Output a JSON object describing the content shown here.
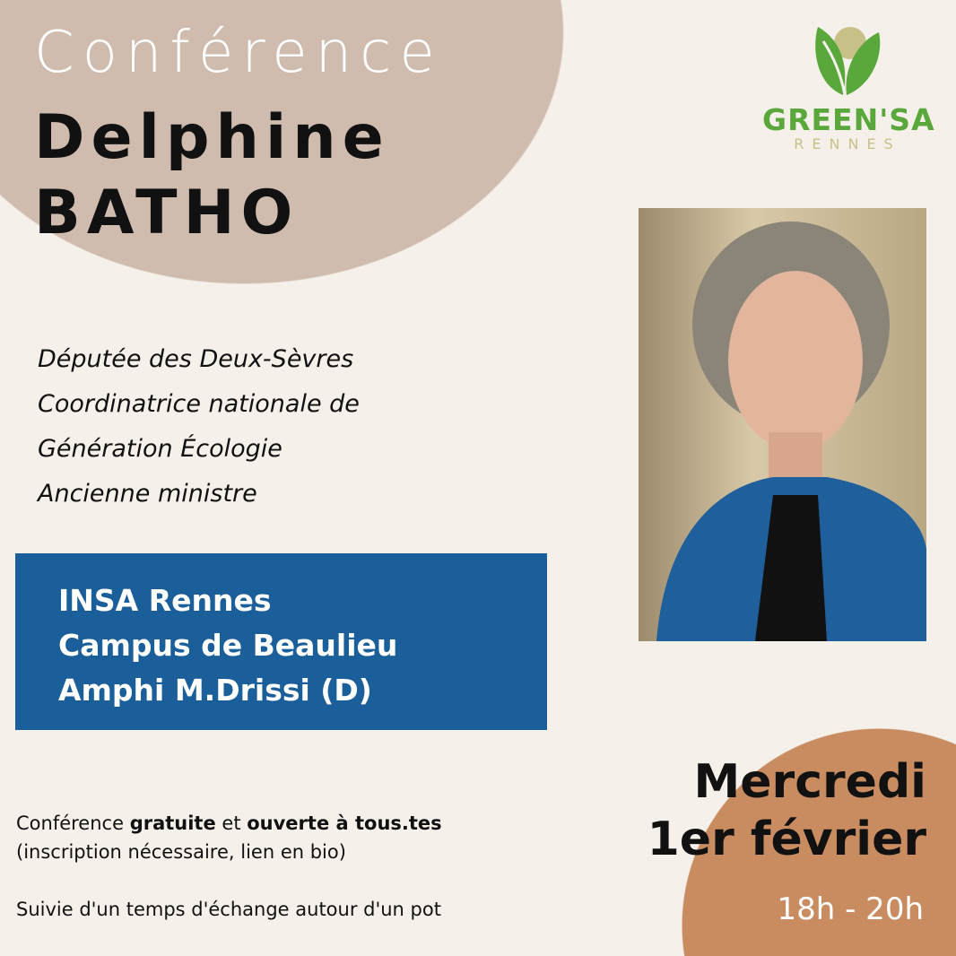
{
  "header": {
    "kicker": "Conférence",
    "first_name": "Delphine",
    "last_name": "BATHO"
  },
  "logo": {
    "name": "GREEN'SA",
    "city": "RENNES"
  },
  "roles": [
    "Députée des Deux-Sèvres",
    "Coordinatrice nationale de",
    "Génération Écologie",
    "Ancienne ministre"
  ],
  "location": [
    "INSA Rennes",
    "Campus de Beaulieu",
    "Amphi M.Drissi (D)"
  ],
  "info": {
    "l1_a": "Conférence ",
    "l1_b": "gratuite",
    "l1_c": " et ",
    "l1_d": "ouverte à tous.tes",
    "l2": "(inscription nécessaire, lien en bio)",
    "l3": "Suivie d'un temps d'échange autour d'un pot"
  },
  "date": {
    "day": "Mercredi",
    "date": "1er février",
    "time": "18h - 20h"
  },
  "colors": {
    "background": "#f6f0ea",
    "blob": "#cfbcae",
    "blue": "#1b5f9a",
    "accent": "#c98c60",
    "green": "#5aa83c"
  }
}
